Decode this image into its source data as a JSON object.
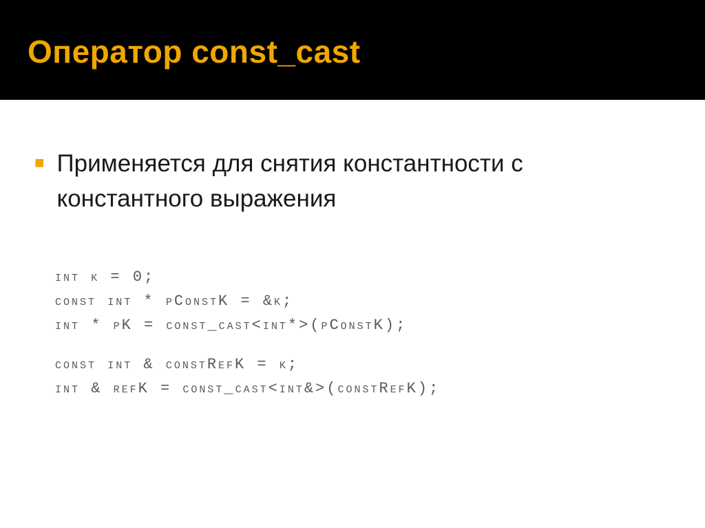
{
  "slide": {
    "title": "Оператор const_cast",
    "bullet_text": "Применяется для снятия константности с константного выражения",
    "code": {
      "line1": "int k = 0;",
      "line2": "const int * pConstK = &k;",
      "line3": "int * pK = const_cast<int*>(pConstK);",
      "line4": "const int & constRefK = k;",
      "line5": "int & refK = const_cast<int&>(constRefK);"
    }
  }
}
